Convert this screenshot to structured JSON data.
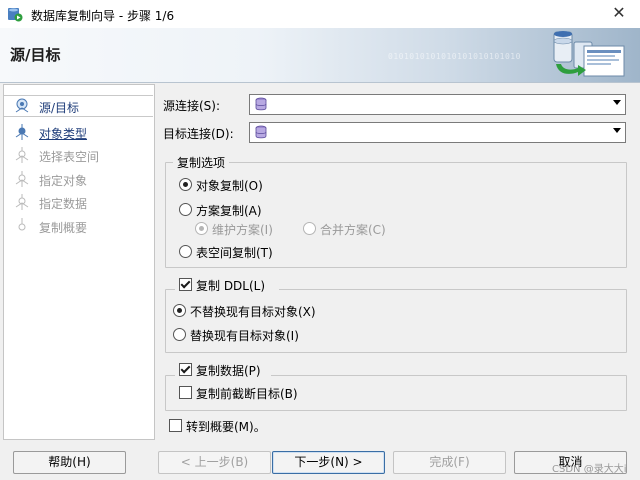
{
  "window": {
    "title": "数据库复制向导 - 步骤 1/6",
    "close_glyph": "✕"
  },
  "banner": {
    "title": "源/目标",
    "bits_text": "0101010101010101010101010"
  },
  "steps": [
    {
      "label": "源/目标",
      "state": "active"
    },
    {
      "label": "对象类型",
      "state": "link"
    },
    {
      "label": "选择表空间",
      "state": "disabled"
    },
    {
      "label": "指定对象",
      "state": "disabled"
    },
    {
      "label": "指定数据",
      "state": "disabled"
    },
    {
      "label": "复制概要",
      "state": "disabled"
    }
  ],
  "connections": {
    "source_label": "源连接(S):",
    "target_label": "目标连接(D):",
    "source_value": "",
    "target_value": ""
  },
  "copy_options": {
    "legend": "复制选项",
    "object_copy": "对象复制(O)",
    "schema_copy": "方案复制(A)",
    "maintain_schema": "维护方案(I)",
    "merge_schema": "合并方案(C)",
    "tablespace_copy": "表空间复制(T)",
    "selected": "object_copy"
  },
  "ddl": {
    "label": "复制 DDL(L)",
    "checked": true,
    "no_replace": "不替换现有目标对象(X)",
    "replace": "替换现有目标对象(I)",
    "selected": "no_replace"
  },
  "data": {
    "label": "复制数据(P)",
    "checked": true,
    "truncate": "复制前截断目标(B)",
    "truncate_checked": false
  },
  "goto_summary": {
    "label": "转到概要(M)。",
    "checked": false
  },
  "buttons": {
    "help": "帮助(H)",
    "back": "< 上一步(B)",
    "next": "下一步(N) >",
    "finish": "完成(F)",
    "cancel": "取消"
  },
  "watermark": "CSDN @录大大i",
  "colors": {
    "link": "#1f3d7a",
    "disabled": "#9a9a9a",
    "banner_end": "#9fb5ca"
  }
}
